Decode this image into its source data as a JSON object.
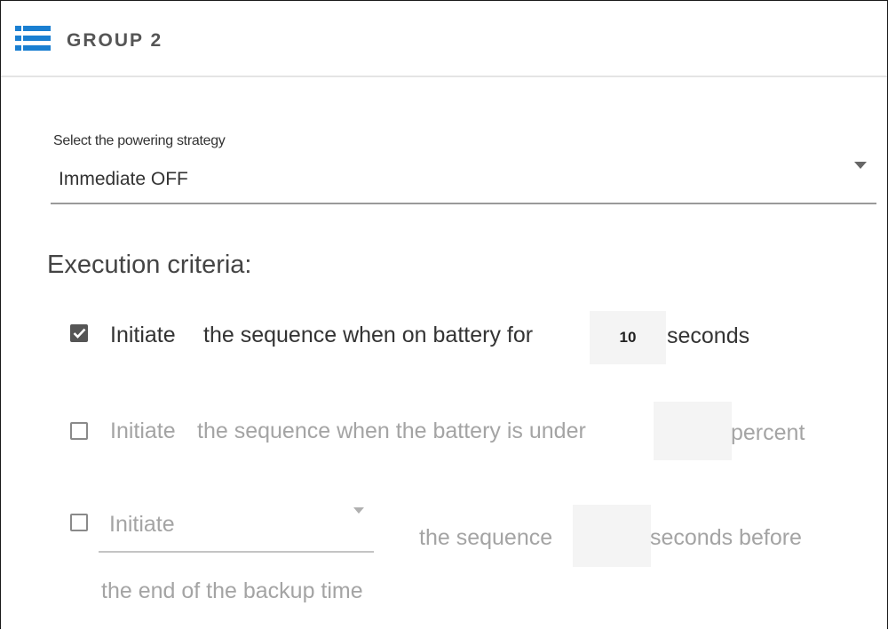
{
  "header": {
    "title": "GROUP 2",
    "icon": "list-icon",
    "accent_color": "#1a7fd1"
  },
  "powering_strategy": {
    "label": "Select the powering strategy",
    "selected_value": "Immediate OFF"
  },
  "execution_criteria": {
    "title": "Execution criteria:",
    "battery_time": {
      "checked": true,
      "text_before_1": "Initiate",
      "text_before_2": "the sequence when on battery for",
      "value": "10",
      "text_after": "seconds"
    },
    "battery_level": {
      "checked": false,
      "text_before_1": "Initiate",
      "text_before_2": "the sequence when the battery is under",
      "value": "",
      "text_after": "percent"
    },
    "backup_time": {
      "checked": false,
      "select_value": "Initiate",
      "text_middle": "the sequence",
      "value": "",
      "text_after": "seconds before",
      "text_line2": "the end of the backup time"
    }
  }
}
